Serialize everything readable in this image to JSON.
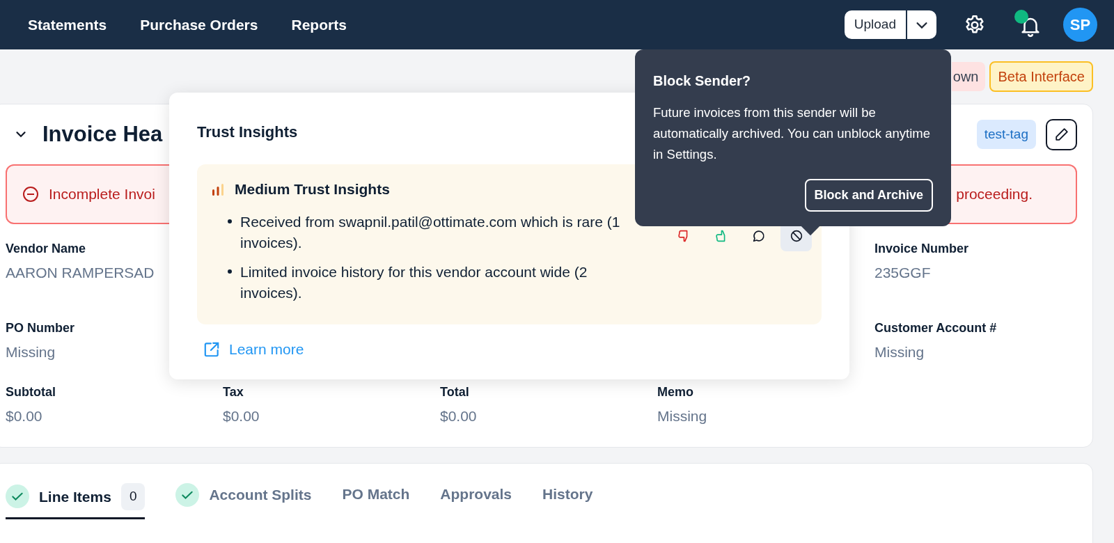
{
  "nav": {
    "items": [
      {
        "label": "Statements"
      },
      {
        "label": "Purchase Orders"
      },
      {
        "label": "Reports"
      }
    ]
  },
  "header": {
    "upload_button": "Upload",
    "notifications": {
      "unread": true
    },
    "avatar": "SP"
  },
  "status_badges": [
    {
      "label": "own",
      "kind": "danger"
    },
    {
      "label": "Beta Interface",
      "kind": "warning"
    }
  ],
  "invoice_header": {
    "title": "Invoice Hea",
    "expanded": true,
    "tag": "test-tag",
    "alert": {
      "text": "Incomplete Invoi",
      "text_right": "proceeding."
    },
    "rows": [
      [
        {
          "label": "Vendor Name",
          "value": "AARON RAMPERSAD"
        },
        null,
        null,
        null,
        {
          "label": "Invoice Number",
          "value": "235GGF"
        }
      ],
      [
        {
          "label": "PO Number",
          "value": "Missing"
        },
        null,
        null,
        null,
        {
          "label": "Customer Account #",
          "value": "Missing"
        }
      ],
      [
        {
          "label": "Subtotal",
          "value": "$0.00"
        },
        {
          "label": "Tax",
          "value": "$0.00"
        },
        {
          "label": "Total",
          "value": "$0.00"
        },
        {
          "label": "Memo",
          "value": "Missing"
        },
        null
      ]
    ]
  },
  "tabs": [
    {
      "label": "Line Items",
      "selected": true,
      "complete": true,
      "count": "0"
    },
    {
      "label": "Account Splits",
      "selected": false,
      "complete": true
    },
    {
      "label": "PO Match",
      "selected": false,
      "complete": false
    },
    {
      "label": "Approvals",
      "selected": false,
      "complete": false
    },
    {
      "label": "History",
      "selected": false,
      "complete": false
    }
  ],
  "trust_insights": {
    "title": "Trust Insights",
    "heading": "Medium Trust Insights",
    "insights": [
      "Received from swapnil.patil@ottimate.com which is rare (1 invoices).",
      "Limited invoice history for this vendor account wide (2 invoices)."
    ],
    "link": "Learn more"
  },
  "block_tooltip": {
    "title": "Block Sender?",
    "body": "Future invoices from this sender will be automatically archived. You can unblock anytime in Settings.",
    "button": "Block and Archive"
  }
}
